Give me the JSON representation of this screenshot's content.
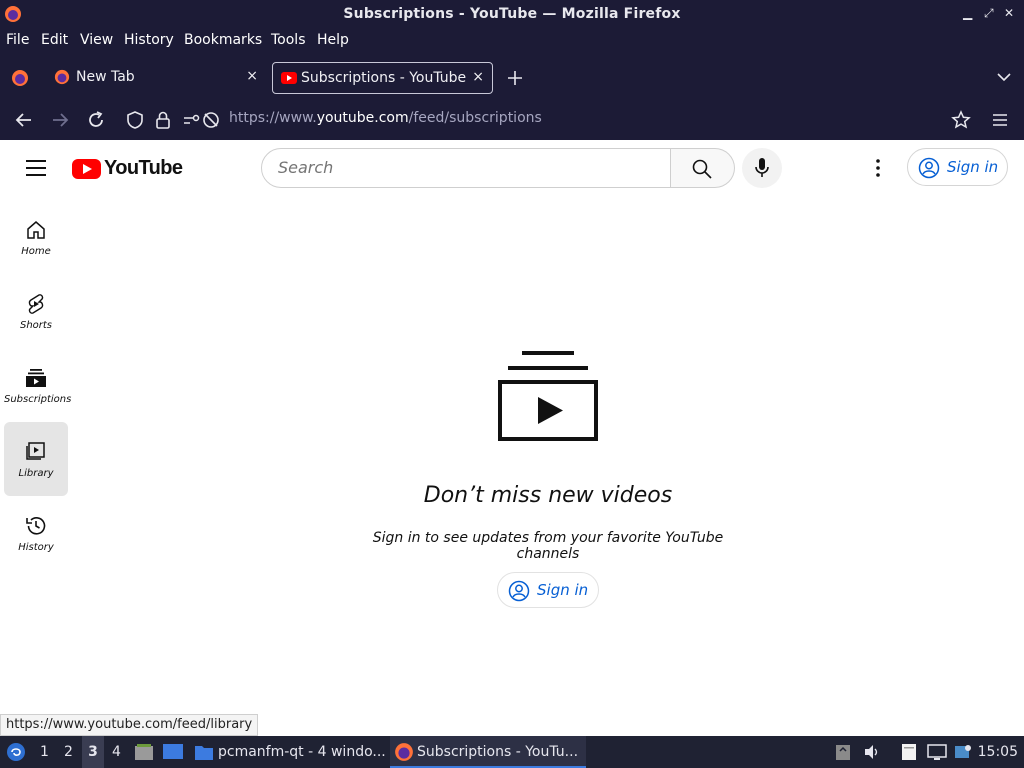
{
  "window": {
    "title": "Subscriptions - YouTube — Mozilla Firefox"
  },
  "menu": [
    "File",
    "Edit",
    "View",
    "History",
    "Bookmarks",
    "Tools",
    "Help"
  ],
  "tabs": [
    {
      "label": "New Tab",
      "close": "×"
    },
    {
      "label": "Subscriptions - YouTube",
      "close": "×",
      "active": true
    }
  ],
  "navbar": {
    "url_prefix": "https://www.",
    "url_domain": "youtube.com",
    "url_path": "/feed/subscriptions"
  },
  "yt": {
    "logo_text": "YouTube",
    "search_placeholder": "Search",
    "signin_label": "Sign in",
    "sidebar": [
      {
        "label": "Home",
        "icon": "home-icon"
      },
      {
        "label": "Shorts",
        "icon": "shorts-icon"
      },
      {
        "label": "Subscriptions",
        "icon": "subscriptions-icon"
      },
      {
        "label": "Library",
        "icon": "library-icon",
        "active": true
      },
      {
        "label": "History",
        "icon": "history-icon"
      }
    ],
    "empty_title": "Don’t miss new videos",
    "empty_subtitle": "Sign in to see updates from your favorite YouTube channels",
    "empty_signin": "Sign in"
  },
  "status_url": "https://www.youtube.com/feed/library",
  "taskbar": {
    "workspaces": [
      "1",
      "2",
      "3",
      "4"
    ],
    "tasks": [
      {
        "label": "pcmanfm-qt - 4 windo..."
      },
      {
        "label": "Subscriptions - YouTu..."
      }
    ],
    "clock": "15:05"
  },
  "colors": {
    "chrome": "#1c1b36",
    "yt_red": "#ff0000",
    "link_blue": "#065fd4"
  }
}
